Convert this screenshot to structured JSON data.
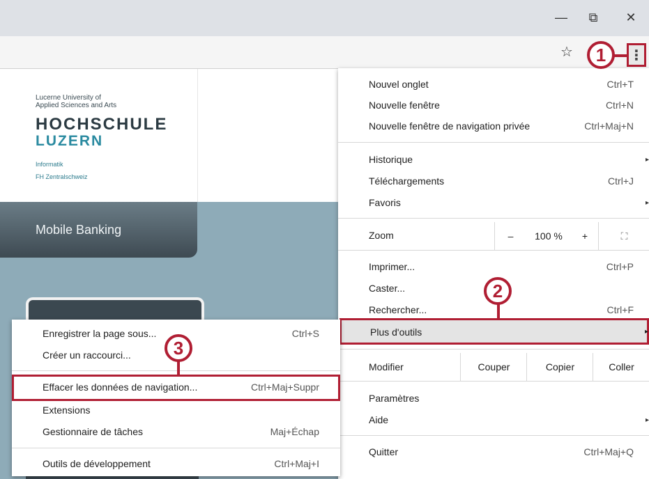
{
  "window": {
    "minimize_glyph": "—",
    "restore_glyph": "⧉",
    "close_glyph": "✕"
  },
  "toolbar": {
    "star_glyph": "☆",
    "menu_glyph": "⋮"
  },
  "callouts": [
    "1",
    "2",
    "3"
  ],
  "page": {
    "logo_small_1": "Lucerne University of",
    "logo_small_2": "Applied Sciences and Arts",
    "logo_big_1": "HOCHSCHULE",
    "logo_big_2": "LUZERN",
    "logo_sub_1": "Informatik",
    "logo_sub_2": "FH Zentralschweiz",
    "nav_label": "Mobile Banking"
  },
  "menu": {
    "items": [
      {
        "label": "Nouvel onglet",
        "shortcut": "Ctrl+T"
      },
      {
        "label": "Nouvelle fenêtre",
        "shortcut": "Ctrl+N"
      },
      {
        "label": "Nouvelle fenêtre de navigation privée",
        "shortcut": "Ctrl+Maj+N"
      },
      {
        "label": "Historique",
        "shortcut": ""
      },
      {
        "label": "Téléchargements",
        "shortcut": "Ctrl+J"
      },
      {
        "label": "Favoris",
        "shortcut": ""
      },
      {
        "label": "Imprimer...",
        "shortcut": "Ctrl+P"
      },
      {
        "label": "Caster...",
        "shortcut": ""
      },
      {
        "label": "Rechercher...",
        "shortcut": "Ctrl+F"
      },
      {
        "label": "Plus d'outils",
        "shortcut": ""
      },
      {
        "label": "Paramètres",
        "shortcut": ""
      },
      {
        "label": "Aide",
        "shortcut": ""
      },
      {
        "label": "Quitter",
        "shortcut": "Ctrl+Maj+Q"
      }
    ],
    "zoom": {
      "label": "Zoom",
      "minus": "–",
      "value": "100 %",
      "plus": "+",
      "fullscreen_glyph": "⛶"
    },
    "edit": {
      "label": "Modifier",
      "cut": "Couper",
      "copy": "Copier",
      "paste": "Coller"
    },
    "submenu_arrow": "▸"
  },
  "submenu": {
    "items": [
      {
        "label": "Enregistrer la page sous...",
        "shortcut": "Ctrl+S"
      },
      {
        "label": "Créer un raccourci...",
        "shortcut": ""
      },
      {
        "label": "Effacer les données de navigation...",
        "shortcut": "Ctrl+Maj+Suppr"
      },
      {
        "label": "Extensions",
        "shortcut": ""
      },
      {
        "label": "Gestionnaire de tâches",
        "shortcut": "Maj+Échap"
      },
      {
        "label": "Outils de développement",
        "shortcut": "Ctrl+Maj+I"
      }
    ]
  },
  "colors": {
    "highlight": "#b01e33",
    "page_bg": "#8eabb8"
  }
}
